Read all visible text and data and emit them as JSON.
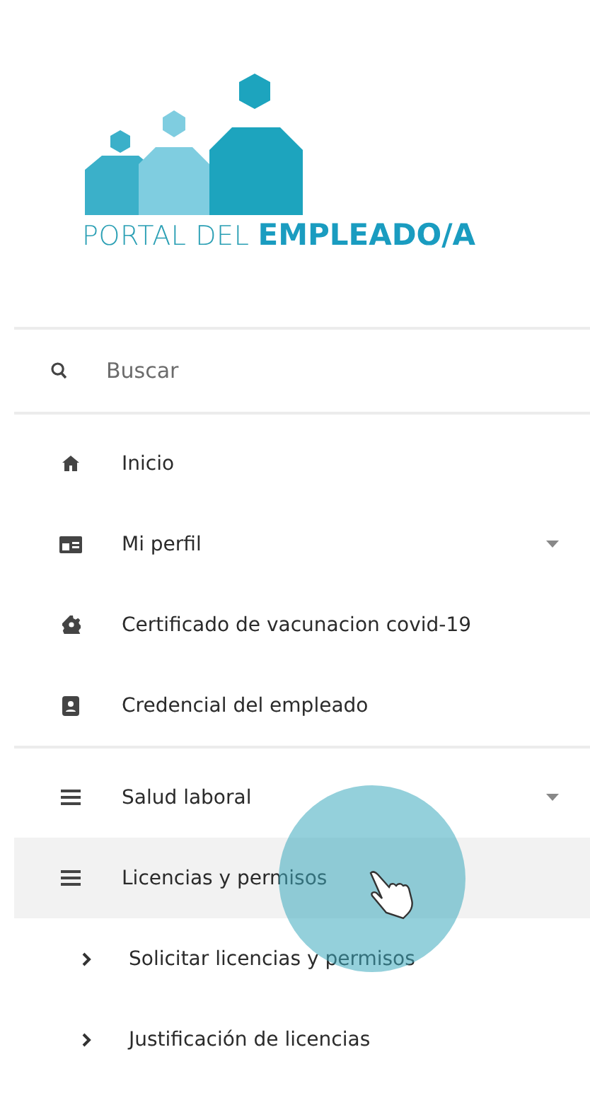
{
  "logo": {
    "light_text": "PORTAL DEL",
    "bold_text": "EMPLEADO/A"
  },
  "search": {
    "placeholder": "Buscar"
  },
  "menu_groups": [
    {
      "items": [
        {
          "label": "Inicio",
          "kind": "home",
          "caret": false,
          "selected": false
        },
        {
          "label": "Mi perfil",
          "kind": "card",
          "caret": true,
          "selected": false
        },
        {
          "label": "Certificado de vacunacion covid-19",
          "kind": "gear",
          "caret": false,
          "selected": false
        },
        {
          "label": "Credencial del empleado",
          "kind": "badge",
          "caret": false,
          "selected": false
        }
      ]
    },
    {
      "items": [
        {
          "label": "Salud laboral",
          "kind": "bars",
          "caret": true,
          "selected": false
        },
        {
          "label": "Licencias y permisos",
          "kind": "bars",
          "caret": false,
          "selected": true,
          "children": [
            {
              "label": "Solicitar licencias y permisos"
            },
            {
              "label": "Justificación de licencias"
            }
          ]
        }
      ]
    }
  ],
  "touch_indicator": {
    "visible": true
  }
}
